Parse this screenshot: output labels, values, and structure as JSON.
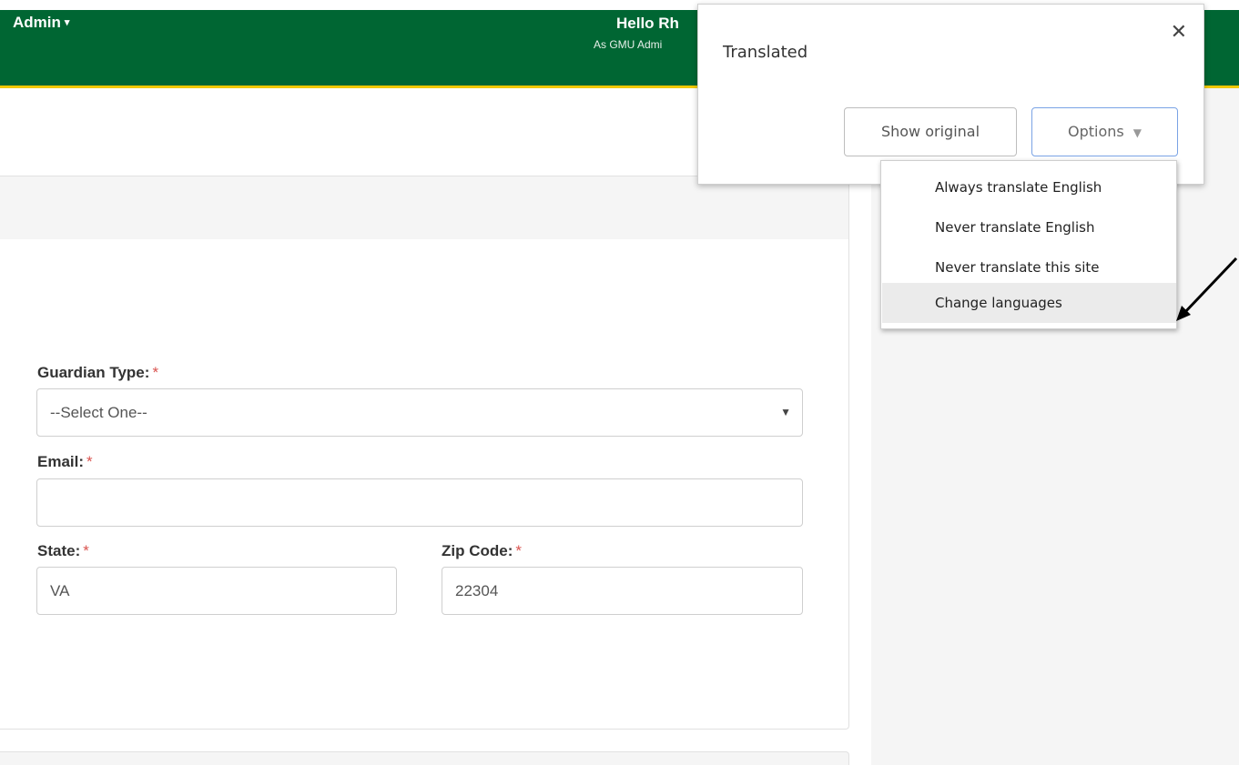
{
  "nav": {
    "admin_label": "Admin",
    "admin_caret": "▾",
    "hello_text": "Hello Rh",
    "as_admin_text": "As GMU Admi"
  },
  "form": {
    "guardian_type": {
      "label": "Guardian Type:",
      "required": "*",
      "value": "--Select One--",
      "arrow": "▼"
    },
    "email": {
      "label": "Email:",
      "required": "*",
      "value": ""
    },
    "state": {
      "label": "State:",
      "required": "*",
      "value": "VA"
    },
    "zip": {
      "label": "Zip Code:",
      "required": "*",
      "value": "22304"
    }
  },
  "translate_popup": {
    "title": "Translated",
    "close_glyph": "✕",
    "show_original": "Show original",
    "options": "Options",
    "options_caret": "▼",
    "menu": [
      {
        "label": "Always translate English"
      },
      {
        "label": "Never translate English"
      },
      {
        "label": "Never translate this site"
      },
      {
        "label": "Change languages",
        "highlighted": true
      }
    ]
  },
  "colors": {
    "nav_green": "#006633",
    "nav_gold_line": "#f0c800",
    "required_red": "#d9534f",
    "options_border": "#7aa3e5"
  }
}
